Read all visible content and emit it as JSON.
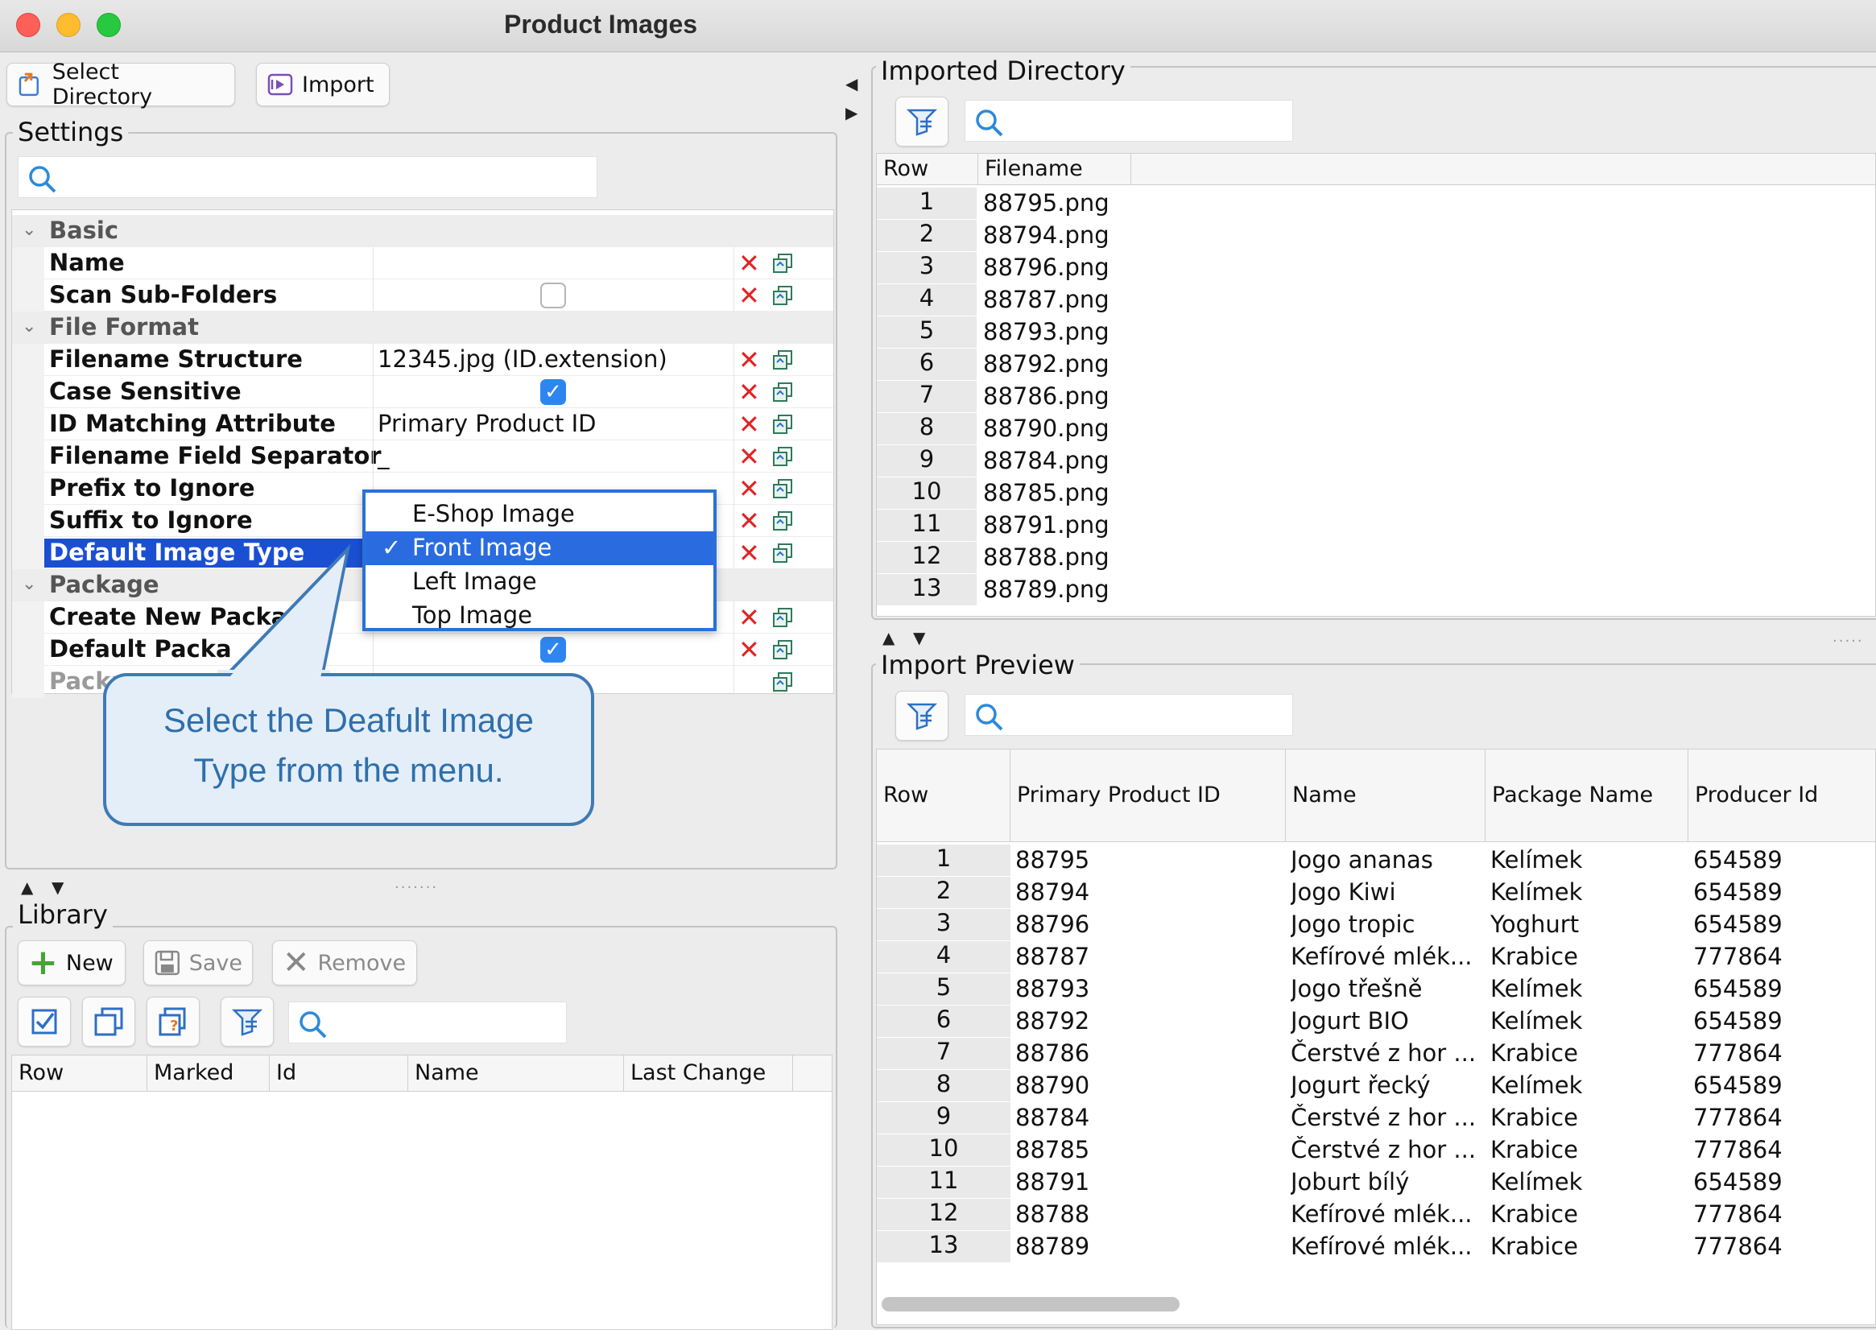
{
  "window": {
    "title": "Product Images"
  },
  "toolbar": {
    "select_directory": "Select Directory",
    "import": "Import"
  },
  "settings": {
    "legend": "Settings",
    "search_placeholder": "",
    "rows": [
      {
        "type": "category",
        "label": "Basic"
      },
      {
        "type": "prop",
        "label": "Name",
        "value": ""
      },
      {
        "type": "prop",
        "label": "Scan Sub-Folders",
        "checkbox": false
      },
      {
        "type": "category",
        "label": "File Format"
      },
      {
        "type": "prop",
        "label": "Filename Structure",
        "value": "12345.jpg (ID.extension)"
      },
      {
        "type": "prop",
        "label": "Case Sensitive",
        "checkbox": true
      },
      {
        "type": "prop",
        "label": "ID Matching Attribute",
        "value": "Primary Product ID"
      },
      {
        "type": "prop",
        "label": "Filename Field Separator",
        "value": "_"
      },
      {
        "type": "prop",
        "label": "Prefix to Ignore",
        "value": ""
      },
      {
        "type": "prop",
        "label": "Suffix to Ignore",
        "value": ""
      },
      {
        "type": "prop",
        "label": "Default Image Type",
        "value": "",
        "selected": true
      },
      {
        "type": "category",
        "label": "Package"
      },
      {
        "type": "prop",
        "label": "Create New Packa",
        "value": ""
      },
      {
        "type": "prop",
        "label": "Default Packa",
        "checkbox": true
      },
      {
        "type": "prop",
        "label": "Packa",
        "value": "",
        "dim": true
      }
    ],
    "dropdown": {
      "options": [
        "E-Shop Image",
        "Front Image",
        "Left Image",
        "Top Image"
      ],
      "selected": "Front Image",
      "check_mark": "✓"
    },
    "callout": "Select the Deafult Image Type from the menu."
  },
  "library": {
    "legend": "Library",
    "new": "New",
    "save": "Save",
    "remove": "Remove",
    "columns": [
      "Row",
      "Marked",
      "Id",
      "Name",
      "Last Change"
    ]
  },
  "imported_directory": {
    "legend": "Imported Directory",
    "columns": [
      "Row",
      "Filename"
    ],
    "rows": [
      [
        "1",
        "88795.png"
      ],
      [
        "2",
        "88794.png"
      ],
      [
        "3",
        "88796.png"
      ],
      [
        "4",
        "88787.png"
      ],
      [
        "5",
        "88793.png"
      ],
      [
        "6",
        "88792.png"
      ],
      [
        "7",
        "88786.png"
      ],
      [
        "8",
        "88790.png"
      ],
      [
        "9",
        "88784.png"
      ],
      [
        "10",
        "88785.png"
      ],
      [
        "11",
        "88791.png"
      ],
      [
        "12",
        "88788.png"
      ],
      [
        "13",
        "88789.png"
      ]
    ]
  },
  "import_preview": {
    "legend": "Import Preview",
    "columns": [
      "Row",
      "Primary Product ID",
      "Name",
      "Package Name",
      "Producer Id"
    ],
    "rows": [
      [
        "1",
        "88795",
        "Jogo ananas",
        "Kelímek",
        "654589"
      ],
      [
        "2",
        "88794",
        "Jogo Kiwi",
        "Kelímek",
        "654589"
      ],
      [
        "3",
        "88796",
        "Jogo tropic",
        "Yoghurt",
        "654589"
      ],
      [
        "4",
        "88787",
        "Kefírové mlék...",
        "Krabice",
        "777864"
      ],
      [
        "5",
        "88793",
        "Jogo třešně",
        "Kelímek",
        "654589"
      ],
      [
        "6",
        "88792",
        "Jogurt BIO",
        "Kelímek",
        "654589"
      ],
      [
        "7",
        "88786",
        "Čerstvé z hor ...",
        "Krabice",
        "777864"
      ],
      [
        "8",
        "88790",
        "Jogurt řecký",
        "Kelímek",
        "654589"
      ],
      [
        "9",
        "88784",
        "Čerstvé z hor ...",
        "Krabice",
        "777864"
      ],
      [
        "10",
        "88785",
        "Čerstvé z hor ...",
        "Krabice",
        "777864"
      ],
      [
        "11",
        "88791",
        "Joburt bílý",
        "Kelímek",
        "654589"
      ],
      [
        "12",
        "88788",
        "Kefírové mlék...",
        "Krabice",
        "777864"
      ],
      [
        "13",
        "88789",
        "Kefírové mlék...",
        "Krabice",
        "777864"
      ]
    ]
  },
  "colors": {
    "selection": "#1b4fd3",
    "dropdown_border": "#2a71d6",
    "callout_text": "#2f6fab",
    "delete_icon": "#e02424"
  }
}
